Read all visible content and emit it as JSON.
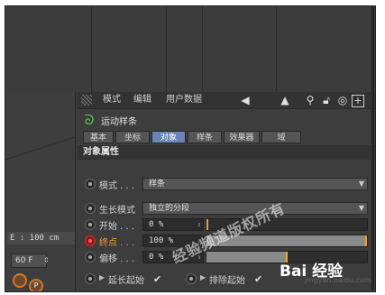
{
  "viewport": {
    "coord_readout": "E : 100 cm",
    "fps_value": "60 F"
  },
  "menubar": {
    "items": [
      "模式",
      "编辑",
      "用户数据"
    ]
  },
  "object": {
    "title": "运动样条"
  },
  "tabs": [
    "基本",
    "坐标",
    "对象",
    "样条",
    "效果器",
    "域"
  ],
  "active_tab": "对象",
  "section": {
    "title": "对象属性"
  },
  "properties": {
    "mode": {
      "label": "模式 . . .",
      "value": "样条"
    },
    "grow_mode": {
      "label": "生长模式",
      "value": "独立的分段"
    },
    "start": {
      "label": "开始 . . .",
      "value": "0 %",
      "fraction": 0
    },
    "end": {
      "label": "终点 . . .",
      "value": "100 %",
      "fraction": 1
    },
    "offset": {
      "label": "偏移 . . .",
      "value": "0 %",
      "fraction": 0.5
    }
  },
  "bottom": {
    "extend_start": "延长起始",
    "exclude_start": "排除起始"
  },
  "watermark": {
    "overlay": "经验频道版权所有",
    "brand": "Bai 经验",
    "url": "jingyan.baidu.com"
  }
}
